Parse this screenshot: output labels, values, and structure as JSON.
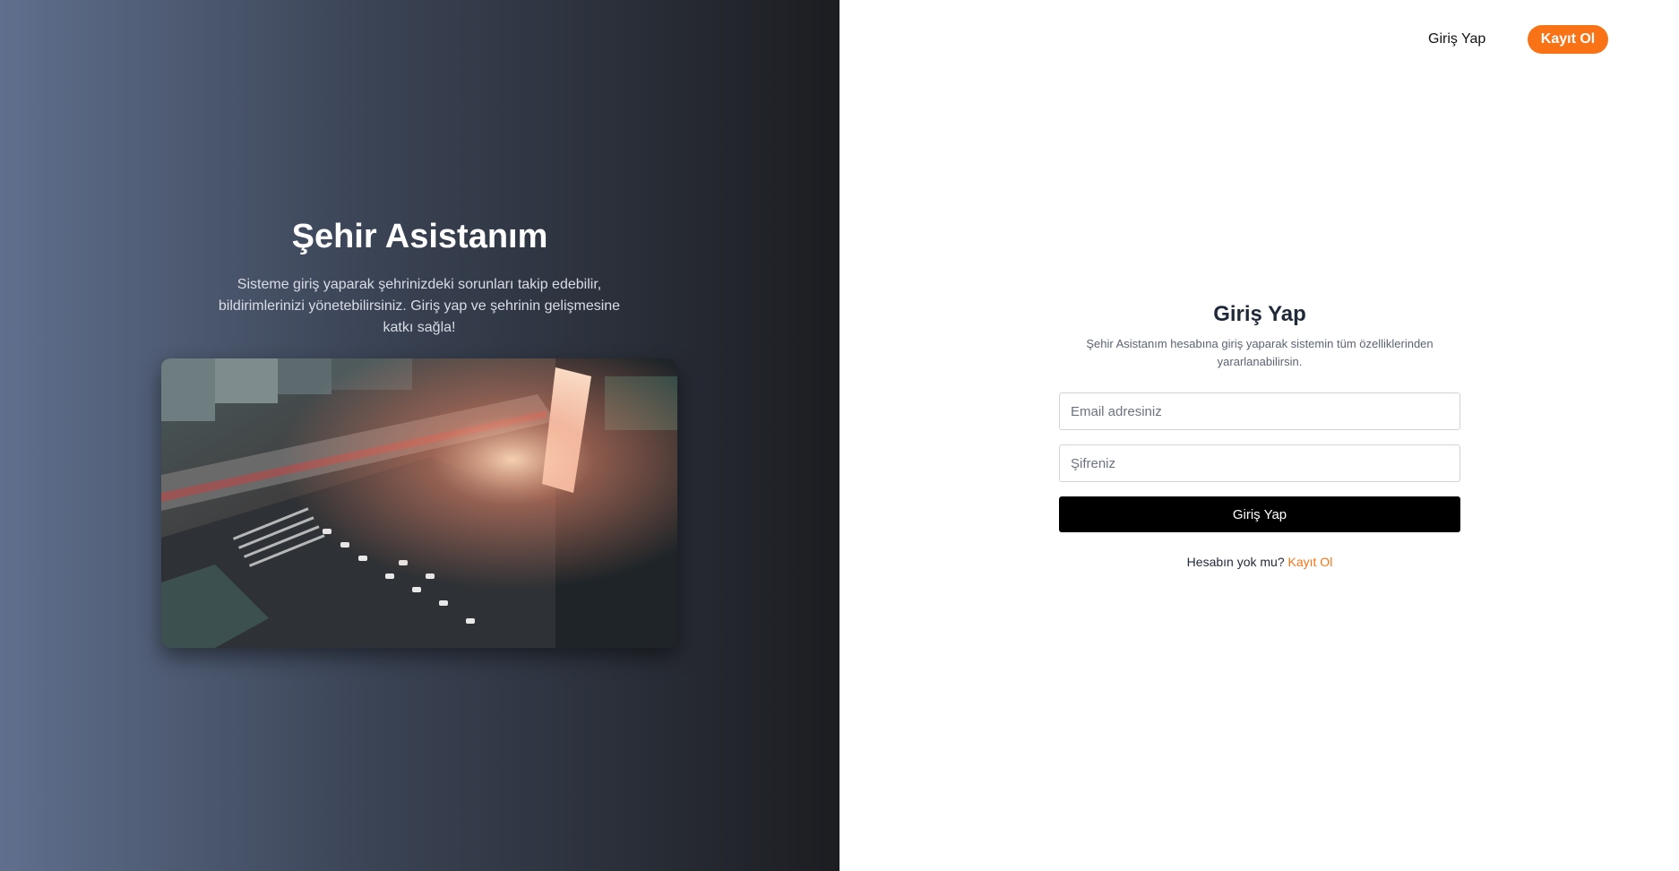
{
  "hero": {
    "title": "Şehir Asistanım",
    "description": "Sisteme giriş yaparak şehrinizdeki sorunları takip edebilir, bildirimlerinizi yönetebilirsiniz. Giriş yap ve şehrinin gelişmesine katkı sağla!"
  },
  "nav": {
    "login_label": "Giriş Yap",
    "register_label": "Kayıt Ol"
  },
  "form": {
    "title": "Giriş Yap",
    "description": "Şehir Asistanım hesabına giriş yaparak sistemin tüm özelliklerinden yararlanabilirsin.",
    "email_placeholder": "Email adresiniz",
    "password_placeholder": "Şifreniz",
    "submit_label": "Giriş Yap",
    "no_account_text": "Hesabın yok mu?",
    "signup_link_label": "Kayıt Ol"
  },
  "colors": {
    "accent": "#f97316",
    "primary_button": "#000000"
  }
}
